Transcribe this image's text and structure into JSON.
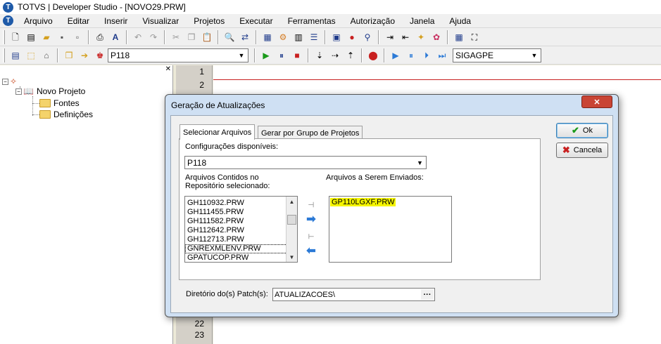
{
  "window": {
    "title": "TOTVS | Developer Studio - [NOVO29.PRW]",
    "logo_letter": "T"
  },
  "menu": [
    "Arquivo",
    "Editar",
    "Inserir",
    "Visualizar",
    "Projetos",
    "Executar",
    "Ferramentas",
    "Autorização",
    "Janela",
    "Ajuda"
  ],
  "toolbar": {
    "project_combo": "P118",
    "env_combo": "SIGAGPE"
  },
  "tree": {
    "project": "Novo Projeto",
    "folders": [
      "Fontes",
      "Definições"
    ]
  },
  "editor": {
    "line_numbers_top": [
      "1",
      "2"
    ],
    "line_numbers_bottom": [
      "22",
      "23"
    ]
  },
  "dialog": {
    "title": "Geração de Atualizações",
    "close_label": "✕",
    "tabs": [
      "Selecionar Arquivos",
      "Gerar por Grupo de Projetos"
    ],
    "config_label": "Configurações disponíveis:",
    "config_value": "P118",
    "repo_label_line1": "Arquivos Contidos no",
    "repo_label_line2": "Repositório selecionado:",
    "sent_label": "Arquivos a Serem Enviados:",
    "repo_files": [
      "GH110932.PRW",
      "GH111455.PRW",
      "GH111582.PRW",
      "GH112642.PRW",
      "GH112713.PRW",
      "GNREXMLENV.PRW",
      "GPATUCOP.PRW"
    ],
    "sent_files": [
      "GP110LGXF.PRW"
    ],
    "patch_label": "Diretório do(s) Patch(s):",
    "patch_value": "ATUALIZACOES\\",
    "ok_label": "Ok",
    "cancel_label": "Cancela"
  },
  "colors": {
    "highlight": "#f5f500",
    "close_button": "#c94434",
    "dialog_frame": "#cfe0f3"
  }
}
